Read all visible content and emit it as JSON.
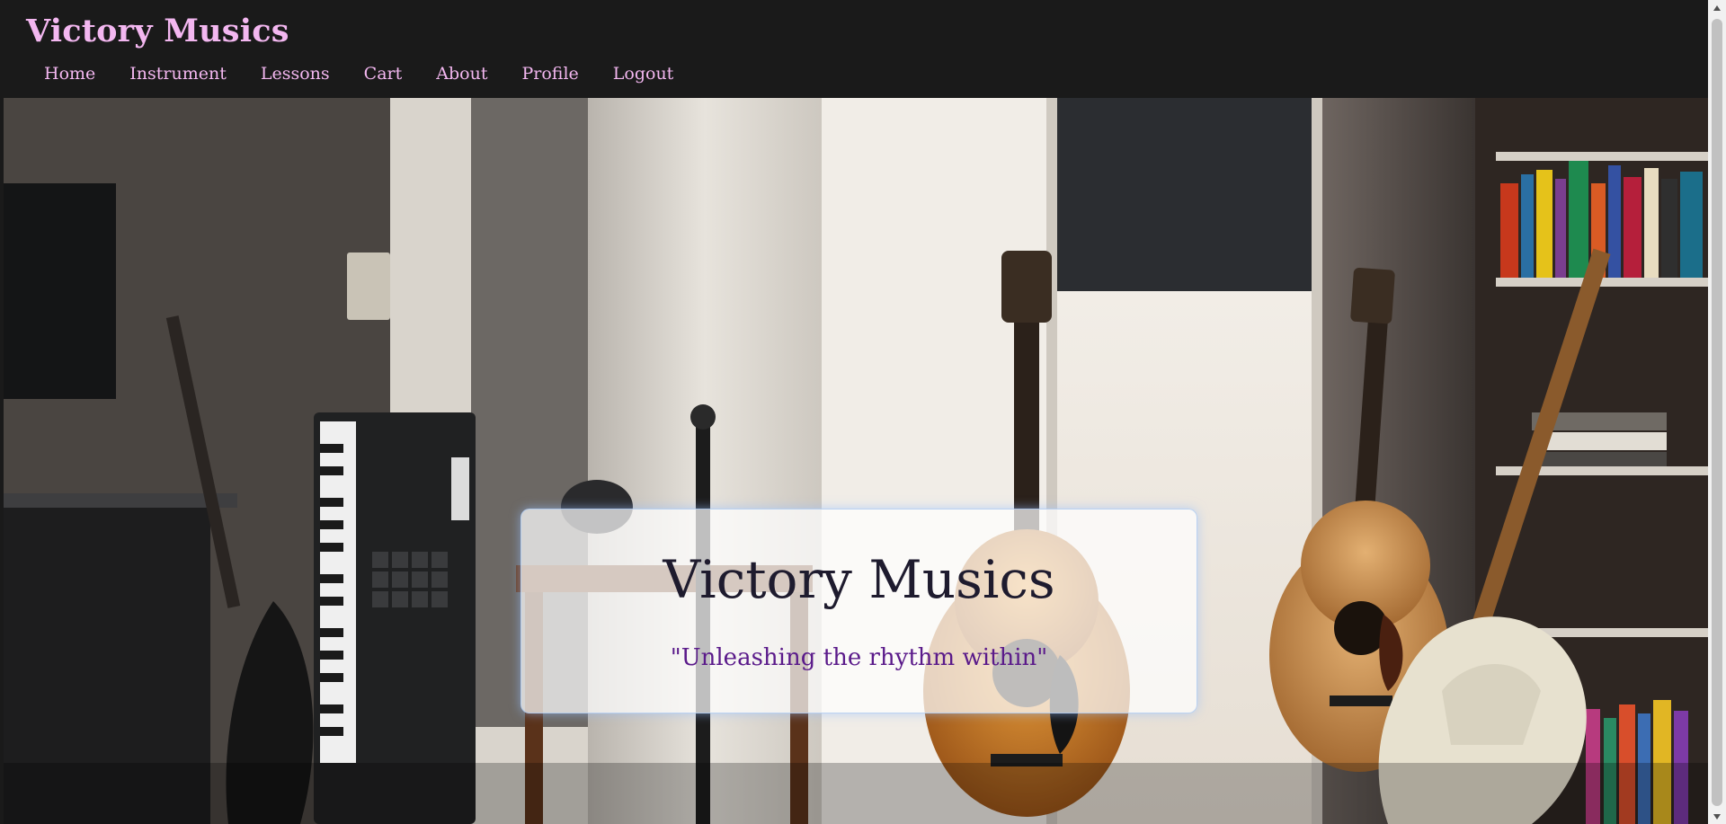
{
  "header": {
    "brand": "Victory Musics",
    "nav": [
      {
        "label": "Home"
      },
      {
        "label": "Instrument"
      },
      {
        "label": "Lessons"
      },
      {
        "label": "Cart"
      },
      {
        "label": "About"
      },
      {
        "label": "Profile"
      },
      {
        "label": "Logout"
      }
    ]
  },
  "hero": {
    "image_description": "music room with guitars, keyboard, and bookshelf",
    "card": {
      "title": "Victory Musics",
      "tagline": "\"Unleashing the rhythm within\""
    }
  },
  "colors": {
    "header_bg": "#1a1a1a",
    "brand": "#f3b7f0",
    "nav_link": "#f3b7f0",
    "card_title": "#1e1b2e",
    "card_tagline": "#5a1a8a"
  },
  "icons": {
    "scroll_up": "triangle-up-icon",
    "scroll_down": "triangle-down-icon"
  }
}
